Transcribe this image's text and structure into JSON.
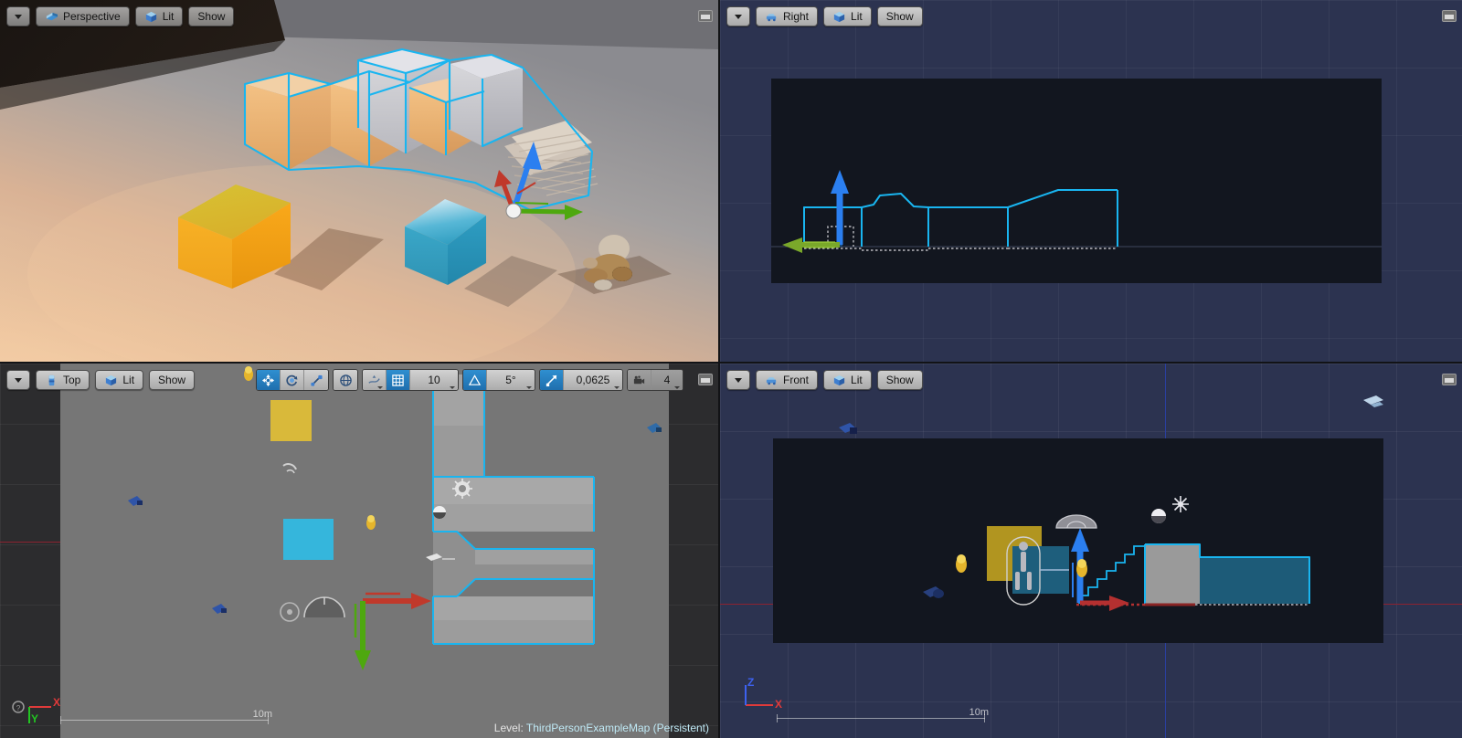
{
  "app": {
    "title": "Unreal Engine Editor — Four Viewport Layout",
    "level_prefix": "Level:",
    "level_name": "ThirdPersonExampleMap (Persistent)"
  },
  "viewports": [
    {
      "id": "perspective",
      "view_label": "Perspective",
      "view_icon": "perspective-camera-icon",
      "lighting_label": "Lit",
      "lighting_icon": "lit-cube-icon",
      "show_label": "Show",
      "active": false,
      "maximize_label": "Maximize Viewport"
    },
    {
      "id": "right",
      "view_label": "Right",
      "view_icon": "ortho-camera-icon",
      "lighting_label": "Lit",
      "lighting_icon": "lit-cube-icon",
      "show_label": "Show",
      "active": false,
      "maximize_label": "Maximize Viewport"
    },
    {
      "id": "top",
      "view_label": "Top",
      "view_icon": "top-view-icon",
      "lighting_label": "Lit",
      "lighting_icon": "lit-cube-icon",
      "show_label": "Show",
      "active": true,
      "maximize_label": "Maximize Viewport",
      "scale_bar": "10m"
    },
    {
      "id": "front",
      "view_label": "Front",
      "view_icon": "ortho-camera-icon",
      "lighting_label": "Lit",
      "lighting_icon": "lit-cube-icon",
      "show_label": "Show",
      "active": false,
      "maximize_label": "Maximize Viewport",
      "scale_bar": "10m"
    }
  ],
  "transform_toolbar": {
    "mode_group": [
      {
        "name": "translate-mode",
        "icon": "move-gizmo-icon",
        "selected": true
      },
      {
        "name": "rotate-mode",
        "icon": "rotate-gizmo-icon",
        "selected": false
      },
      {
        "name": "scale-mode",
        "icon": "scale-gizmo-icon",
        "selected": false
      }
    ],
    "coordinate_system": {
      "name": "world-coordinate-toggle",
      "icon": "globe-icon",
      "selected": false
    },
    "surface_snap": {
      "name": "surface-snap-toggle",
      "icon": "surface-snap-icon",
      "selected": false
    },
    "grid_snap": {
      "name": "grid-snap-toggle",
      "icon": "grid-icon",
      "selected": true
    },
    "grid_snap_value": "10",
    "angle_snap": {
      "name": "angle-snap-toggle",
      "icon": "angle-icon",
      "selected": true
    },
    "angle_snap_value": "5°",
    "scale_snap": {
      "name": "scale-snap-toggle",
      "icon": "scale-snap-icon",
      "selected": true
    },
    "scale_snap_value": "0,0625",
    "camera_speed": {
      "name": "camera-speed",
      "icon": "camera-icon",
      "value": "4"
    }
  },
  "axis_indicators": {
    "top": {
      "x_label": "X",
      "y_label": "Y",
      "x_color": "#e03a3a",
      "y_color": "#22c522"
    },
    "front": {
      "x_label": "X",
      "z_label": "Z",
      "x_color": "#e03a3a",
      "z_color": "#3d62f0"
    }
  },
  "colors": {
    "selection_outline": "#19b5f0",
    "gizmo_x": "#c0392b",
    "gizmo_y": "#4ea80f",
    "gizmo_z": "#2b7ff0",
    "ortho_bg": "#2c3350",
    "ortho_pane": "#12161f",
    "top_bg": "#2c2c2e",
    "top_floor": "#767676",
    "accent_blue": "#2f8fd0",
    "yellow_cube": "#f0a81e",
    "cyan_cube": "#2fa3c4",
    "floor_warm": "#d6b193"
  },
  "scene": {
    "name": "ThirdPersonExampleMap",
    "objects": [
      {
        "name": "yellow-cube",
        "color": "#f0a81e"
      },
      {
        "name": "cyan-cube",
        "color": "#2fa3c4"
      },
      {
        "name": "staircase-platforms",
        "selected": true,
        "color": "#19b5f0"
      },
      {
        "name": "third-person-character",
        "color": "#b5803f"
      },
      {
        "name": "directional-light",
        "color": "#ffd9a0"
      }
    ]
  }
}
